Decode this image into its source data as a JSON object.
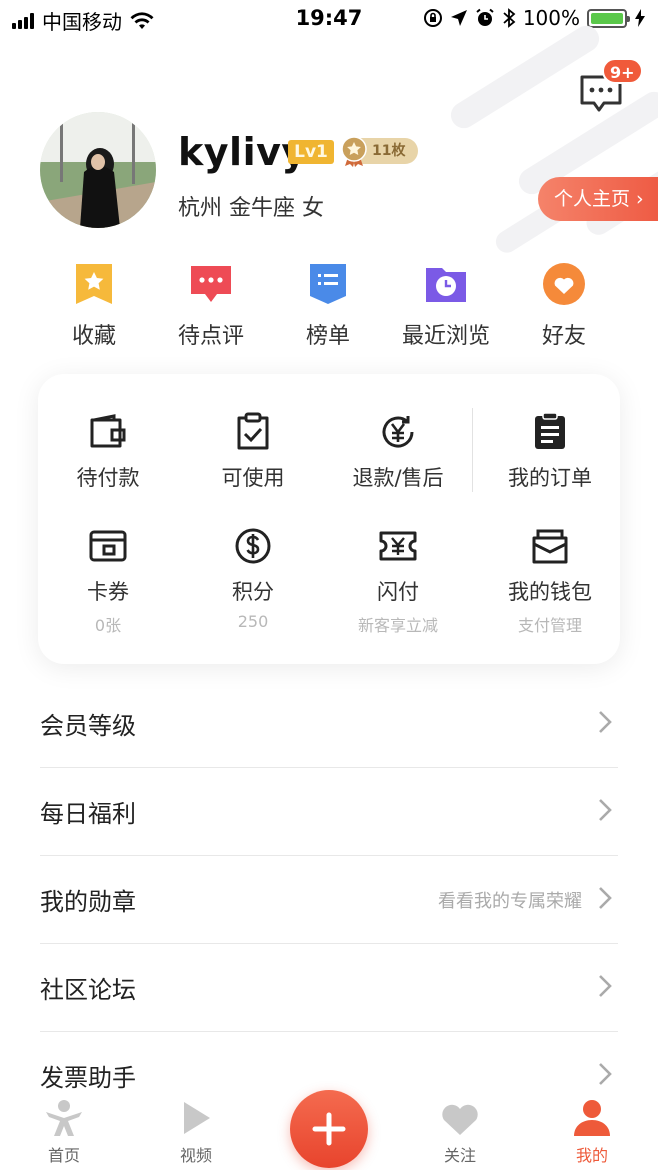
{
  "status_bar": {
    "carrier": "中国移动",
    "time": "19:47",
    "battery": "100%"
  },
  "header": {
    "message_badge": "9+"
  },
  "profile": {
    "username": "kylivy",
    "level": "Lv1",
    "medal_count": "11枚",
    "info": "杭州 金牛座 女",
    "home_button": "个人主页 ›"
  },
  "quick_actions": [
    {
      "label": "收藏",
      "icon": "star-bookmark-icon"
    },
    {
      "label": "待点评",
      "icon": "comment-icon"
    },
    {
      "label": "榜单",
      "icon": "list-ribbon-icon"
    },
    {
      "label": "最近浏览",
      "icon": "clock-folder-icon"
    },
    {
      "label": "好友",
      "icon": "heart-icon"
    }
  ],
  "orders": {
    "row1": [
      {
        "label": "待付款",
        "icon": "wallet-icon"
      },
      {
        "label": "可使用",
        "icon": "clipboard-check-icon"
      },
      {
        "label": "退款/售后",
        "icon": "yen-refund-icon"
      },
      {
        "label": "我的订单",
        "icon": "order-list-icon"
      }
    ],
    "row2": [
      {
        "label": "卡券",
        "sub": "0张",
        "icon": "card-coupon-icon"
      },
      {
        "label": "积分",
        "sub": "250",
        "icon": "dollar-coin-icon"
      },
      {
        "label": "闪付",
        "sub": "新客享立减",
        "icon": "yen-ticket-icon"
      },
      {
        "label": "我的钱包",
        "sub": "支付管理",
        "icon": "purse-icon"
      }
    ]
  },
  "menu": [
    {
      "label": "会员等级",
      "hint": ""
    },
    {
      "label": "每日福利",
      "hint": ""
    },
    {
      "label": "我的勋章",
      "hint": "看看我的专属荣耀"
    },
    {
      "label": "社区论坛",
      "hint": ""
    },
    {
      "label": "发票助手",
      "hint": ""
    }
  ],
  "tabbar": {
    "items": [
      {
        "label": "首页",
        "icon": "home-person-icon"
      },
      {
        "label": "视频",
        "icon": "play-icon"
      },
      {
        "label": "关注",
        "icon": "heart-icon"
      },
      {
        "label": "我的",
        "icon": "user-icon"
      }
    ],
    "active_color": "#ee5a3a",
    "inactive_color": "#c8c8c8"
  },
  "colors": {
    "accent": "#ee5a43",
    "gold": "#f0b531"
  }
}
